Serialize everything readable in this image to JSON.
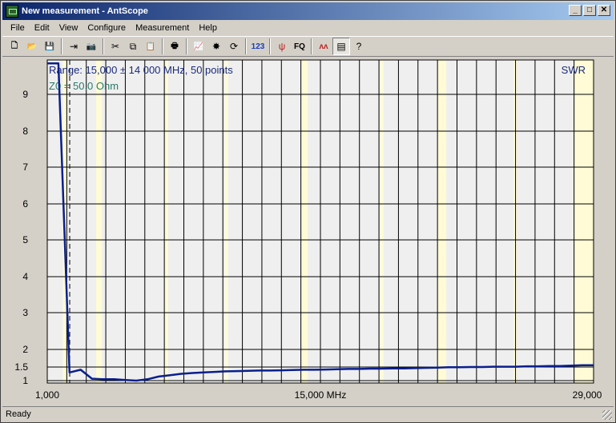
{
  "window": {
    "title": "New measurement - AntScope"
  },
  "menu": [
    "File",
    "Edit",
    "View",
    "Configure",
    "Measurement",
    "Help"
  ],
  "toolbar": [
    {
      "icon": "new-file-icon",
      "glyph": "🗋"
    },
    {
      "icon": "open-folder-icon",
      "glyph": "📂"
    },
    {
      "icon": "save-icon",
      "glyph": "💾"
    },
    {
      "sep": true
    },
    {
      "icon": "export-icon",
      "glyph": "⇥"
    },
    {
      "icon": "camera-icon",
      "glyph": "📷"
    },
    {
      "sep": true
    },
    {
      "icon": "cut-icon",
      "glyph": "✂"
    },
    {
      "icon": "copy-icon",
      "glyph": "⧉"
    },
    {
      "icon": "paste-icon",
      "glyph": "📋"
    },
    {
      "sep": true
    },
    {
      "icon": "print-icon",
      "glyph": "🖶"
    },
    {
      "sep": true
    },
    {
      "icon": "chart-icon",
      "glyph": "📈"
    },
    {
      "icon": "star-burst-icon",
      "glyph": "✸"
    },
    {
      "icon": "refresh-icon",
      "glyph": "⟳"
    },
    {
      "sep": true
    },
    {
      "icon": "numbers-icon",
      "glyph": "123",
      "color": "#1a3cc0"
    },
    {
      "sep": true
    },
    {
      "icon": "antenna-icon",
      "glyph": "ψ",
      "color": "#c02020"
    },
    {
      "icon": "frequency-icon",
      "glyph": "FQ"
    },
    {
      "sep": true
    },
    {
      "icon": "waveform-icon",
      "glyph": "ʌʌ",
      "color": "#c02020"
    },
    {
      "icon": "list-icon",
      "glyph": "▤",
      "pressed": true
    },
    {
      "icon": "help-icon",
      "glyph": "?"
    }
  ],
  "status": "Ready",
  "colors": {
    "trace": "#0a1f8c",
    "band": "#fffbd6",
    "plot_bg": "#efefef",
    "info_text": "#1a2a7c",
    "z0_text": "#2a7a6a"
  },
  "chart_data": {
    "type": "line",
    "info_range": "Range: 15,000 ± 14 000 MHz, 50 points",
    "info_z0": "Z0 = 50,0 Ohm",
    "series_label": "SWR",
    "xlabels": [
      "1,000",
      "15,000 MHz",
      "29,000"
    ],
    "xlim": [
      1,
      29
    ],
    "ylim": [
      1,
      10
    ],
    "yticks": [
      1,
      1.5,
      2,
      3,
      4,
      5,
      6,
      7,
      8,
      9
    ],
    "ytick_labels": [
      "1",
      "1.5",
      "2",
      "3",
      "4",
      "5",
      "6",
      "7",
      "8",
      "9"
    ],
    "marker_x": 2.15,
    "bands": [
      [
        1.8,
        2.0
      ],
      [
        3.5,
        3.8
      ],
      [
        7.0,
        7.2
      ],
      [
        10.1,
        10.15
      ],
      [
        14.0,
        14.35
      ],
      [
        18.07,
        18.17
      ],
      [
        21.0,
        21.45
      ],
      [
        24.89,
        24.99
      ],
      [
        28.0,
        29.0
      ]
    ],
    "series": [
      {
        "name": "SWR",
        "x": [
          1.0,
          1.57,
          2.14,
          2.71,
          3.29,
          3.86,
          4.43,
          5.0,
          5.57,
          6.14,
          6.71,
          7.29,
          7.86,
          8.43,
          9.0,
          9.57,
          10.14,
          10.71,
          11.29,
          11.86,
          12.43,
          13.0,
          13.57,
          14.14,
          14.71,
          15.29,
          15.86,
          16.43,
          17.0,
          17.57,
          18.14,
          18.71,
          19.29,
          19.86,
          20.43,
          21.0,
          21.57,
          22.14,
          22.71,
          23.29,
          23.86,
          24.43,
          25.0,
          25.57,
          26.14,
          26.71,
          27.29,
          27.86,
          28.43,
          29.0
        ],
        "y": [
          9.9,
          9.9,
          1.3,
          1.4,
          1.07,
          1.05,
          1.05,
          1.02,
          1.0,
          1.05,
          1.15,
          1.2,
          1.25,
          1.28,
          1.3,
          1.32,
          1.34,
          1.35,
          1.36,
          1.37,
          1.37,
          1.38,
          1.39,
          1.4,
          1.4,
          1.41,
          1.42,
          1.43,
          1.43,
          1.44,
          1.44,
          1.45,
          1.45,
          1.46,
          1.47,
          1.48,
          1.49,
          1.49,
          1.5,
          1.5,
          1.51,
          1.51,
          1.51,
          1.52,
          1.52,
          1.53,
          1.53,
          1.54,
          1.55,
          1.55
        ]
      }
    ]
  }
}
